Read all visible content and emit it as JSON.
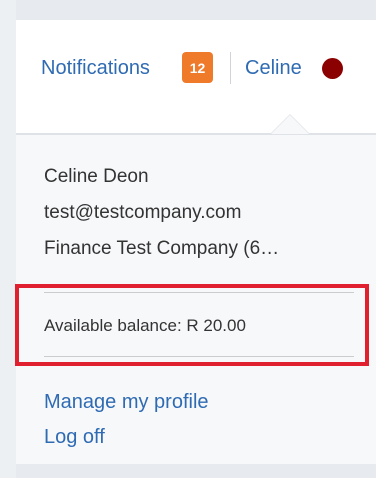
{
  "header": {
    "notifications_label": "Notifications",
    "notifications_count": "12",
    "user_label": "Celine",
    "user_status_color": "#8b0000"
  },
  "dropdown": {
    "user_name": "Celine Deon",
    "user_email": "test@testcompany.com",
    "company": "Finance Test Company (6…",
    "balance": "Available balance: R 20.00",
    "menu": [
      {
        "label": "Manage my profile"
      },
      {
        "label": "Log off"
      }
    ]
  },
  "colors": {
    "link": "#2f6bb3",
    "badge": "#ee7a2a",
    "highlight": "#e0202e"
  }
}
